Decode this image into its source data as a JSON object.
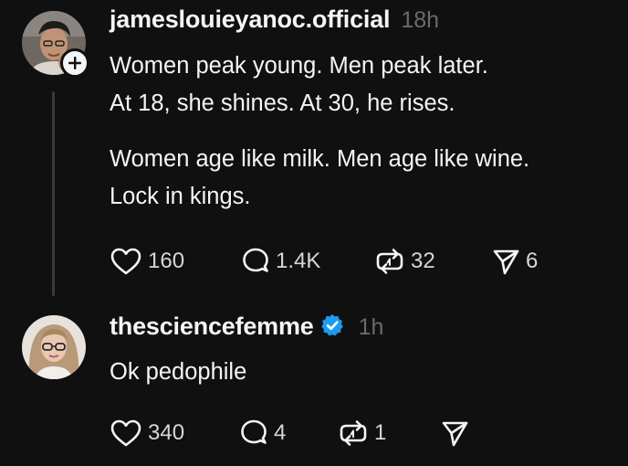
{
  "posts": [
    {
      "username": "jameslouieyanoc.official",
      "time": "18h",
      "lines": [
        "Women peak young. Men peak later.",
        "At 18, she shines. At 30, he rises.",
        "Women age like milk. Men age like wine.",
        "Lock in kings."
      ],
      "actions": {
        "likes": "160",
        "comments": "1.4K",
        "reposts": "32",
        "shares": "6"
      }
    },
    {
      "username": "thesciencefemme",
      "time": "1h",
      "verified": true,
      "lines": [
        "Ok pedophile"
      ],
      "actions": {
        "likes": "340",
        "comments": "4",
        "reposts": "1"
      }
    }
  ],
  "icons": {
    "like": "heart-icon",
    "comment": "comment-bubble-icon",
    "repost": "repost-icon",
    "share": "send-icon",
    "follow": "plus-icon",
    "verified": "verified-badge-icon"
  },
  "colors": {
    "background": "#101010",
    "text": "#f3f5f7",
    "muted": "#6b6b6b",
    "verified": "#1d9bf0",
    "thread_line": "#3a3a3a"
  }
}
